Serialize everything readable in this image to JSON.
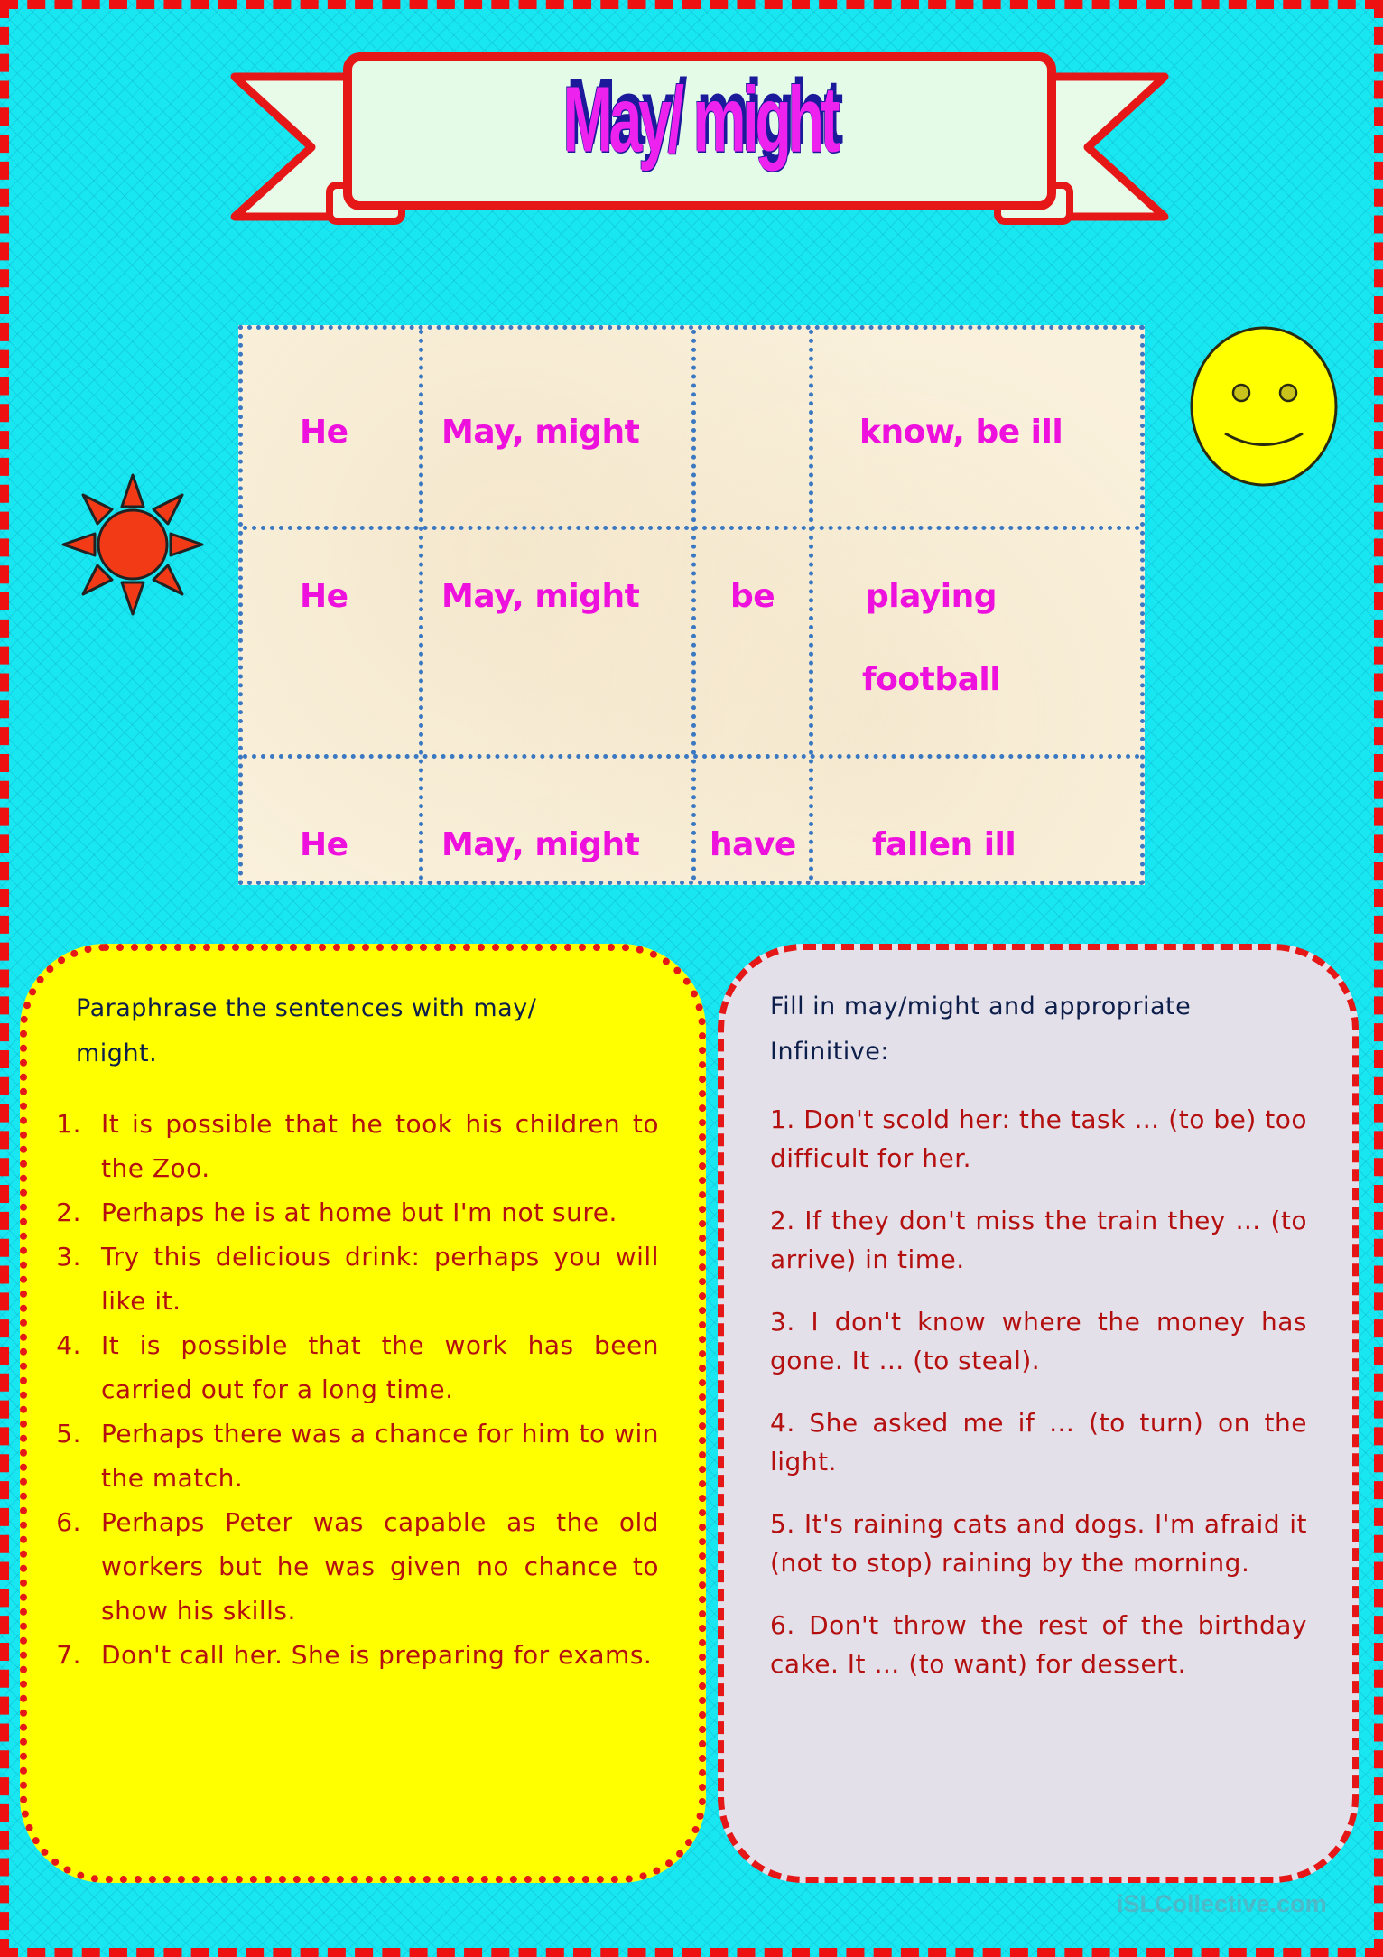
{
  "title": "May/ might",
  "colors": {
    "background": "#18e6f0",
    "page_border": "#ee1111",
    "title_fill": "#ee22ee",
    "title_shadow": "#1a1a9a",
    "table_text": "#ee11dd",
    "table_border": "#3b78c2",
    "left_box_bg": "#ffff00",
    "right_box_bg": "#e3e0ea",
    "exercise_text": "#b41010",
    "heading_text": "#0d1e4a"
  },
  "decorations": {
    "left": "sun-icon",
    "right": "smiley-face-icon"
  },
  "grammar_table": {
    "rows": [
      {
        "subject": "He",
        "modal": "May, might",
        "aux": "",
        "verb": "know, be ill",
        "verb_line2": ""
      },
      {
        "subject": "He",
        "modal": "May, might",
        "aux": "be",
        "verb": "playing",
        "verb_line2": "football"
      },
      {
        "subject": "He",
        "modal": "May, might",
        "aux": "have",
        "verb": "fallen ill",
        "verb_line2": ""
      }
    ]
  },
  "exercise_1": {
    "heading_line1": "Paraphrase the sentences with may/",
    "heading_line2": "might.",
    "items": [
      {
        "num": "1.",
        "text": "It is possible that he took his children to the Zoo."
      },
      {
        "num": "2.",
        "text": "Perhaps he is at home but I'm not sure."
      },
      {
        "num": "3.",
        "text": "Try this delicious drink: perhaps you will like it."
      },
      {
        "num": "4.",
        "text": "It is possible that the work has been carried out for a long time."
      },
      {
        "num": "5.",
        "text": "Perhaps there was a chance for him to win the match."
      },
      {
        "num": "6.",
        "text": "Perhaps Peter was capable as the old workers but he was given no chance to show his skills."
      },
      {
        "num": "7.",
        "text": "Don't call her. She is preparing for exams."
      }
    ]
  },
  "exercise_2": {
    "heading_line1": "Fill in may/might and appropriate",
    "heading_line2": "Infinitive:",
    "items": [
      "1. Don't scold her: the task … (to be) too difficult for her.",
      "2. If they don't miss the train they … (to arrive) in time.",
      "3. I don't know where the money has gone. It … (to steal).",
      "4.  She asked me if … (to turn) on the light.",
      "5. It's raining cats and dogs. I'm afraid it (not to stop) raining by the morning.",
      "6. Don't throw the rest of the birthday cake. It … (to want) for dessert."
    ]
  },
  "watermark": "iSLCollective.com"
}
